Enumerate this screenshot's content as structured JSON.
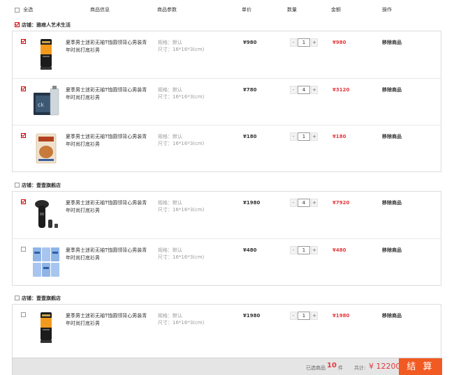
{
  "header": {
    "select_all": "全选",
    "col_info": "商品信息",
    "col_params": "商品参数",
    "col_price": "单价",
    "col_qty": "数量",
    "col_amount": "金额",
    "col_action": "操作"
  },
  "shops": [
    {
      "name": "店铺：雅痞人艺术生活",
      "checked": true,
      "items": [
        {
          "title": "夏季男士迷彩无袖T恤圆领背心男装青年时尚打底衫男",
          "spec1": "规格：默认",
          "spec2": "尺寸：16*16*3(cm)",
          "price": "¥980",
          "qty": "1",
          "minus": "-",
          "plus": "+",
          "total": "¥980",
          "remove": "移除商品",
          "checked": true,
          "icon": "face-wash-tube-icon"
        },
        {
          "title": "夏季男士迷彩无袖T恤圆领背心男装青年时尚打底衫男",
          "spec1": "规格：默认",
          "spec2": "尺寸：16*16*3(cm)",
          "price": "¥780",
          "qty": "4",
          "minus": "-",
          "plus": "+",
          "total": "¥3120",
          "remove": "移除商品",
          "checked": true,
          "icon": "perfume-bottle-icon"
        },
        {
          "title": "夏季男士迷彩无袖T恤圆领背心男装青年时尚打底衫男",
          "spec1": "规格：默认",
          "spec2": "尺寸：16*16*3(cm)",
          "price": "¥180",
          "qty": "1",
          "minus": "-",
          "plus": "+",
          "total": "¥180",
          "remove": "移除商品",
          "checked": true,
          "icon": "food-bag-icon"
        }
      ]
    },
    {
      "name": "店铺：壹壹旗舰店",
      "checked": false,
      "items": [
        {
          "title": "夏季男士迷彩无袖T恤圆领背心男装青年时尚打底衫男",
          "spec1": "规格：默认",
          "spec2": "尺寸：16*16*3(cm)",
          "price": "¥1980",
          "qty": "4",
          "minus": "-",
          "plus": "+",
          "total": "¥7920",
          "remove": "移除商品",
          "checked": true,
          "icon": "electric-shaver-icon"
        },
        {
          "title": "夏季男士迷彩无袖T恤圆领背心男装青年时尚打底衫男",
          "spec1": "规格：默认",
          "spec2": "尺寸：16*16*3(cm)",
          "price": "¥480",
          "qty": "1",
          "minus": "-",
          "plus": "+",
          "total": "¥480",
          "remove": "移除商品",
          "checked": false,
          "icon": "diaper-packs-icon"
        }
      ]
    },
    {
      "name": "店铺：壹壹旗舰店",
      "checked": false,
      "items": [
        {
          "title": "夏季男士迷彩无袖T恤圆领背心男装青年时尚打底衫男",
          "spec1": "规格：默认",
          "spec2": "尺寸：16*16*3(cm)",
          "price": "¥1980",
          "qty": "1",
          "minus": "-",
          "plus": "+",
          "total": "¥1980",
          "remove": "移除商品",
          "checked": false,
          "icon": "face-wash-tube-icon"
        }
      ]
    }
  ],
  "footer": {
    "selected_label": "已选商品",
    "selected_count": "10",
    "selected_unit": "件",
    "sum_label": "共计:",
    "sum_value": "¥ 12200",
    "checkout": "结 算"
  },
  "colors": {
    "accent": "#f15a22",
    "price_red": "#e4393c"
  }
}
